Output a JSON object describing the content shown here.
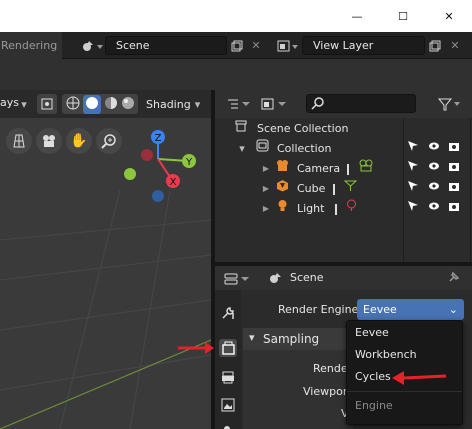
{
  "window": {
    "minimize_label": "—",
    "maximize_label": "☐",
    "close_label": "✕"
  },
  "topbar": {
    "workspace_tab": "Rendering",
    "scene_name": "Scene",
    "view_layer_name": "View Layer"
  },
  "viewport": {
    "mode_fragment": "ays",
    "shading_label": "Shading"
  },
  "outliner": {
    "items": [
      {
        "label": "Scene Collection"
      },
      {
        "label": "Collection"
      },
      {
        "label": "Camera"
      },
      {
        "label": "Cube"
      },
      {
        "label": "Light"
      }
    ]
  },
  "properties": {
    "context_title": "Scene",
    "render_engine_label": "Render Engine",
    "render_engine_value": "Eevee",
    "sampling_label": "Sampling",
    "render_label": "Render",
    "viewport_label": "Viewport",
    "denoising_fragment": "V"
  },
  "engine_dropdown": {
    "options": [
      "Eevee",
      "Workbench",
      "Cycles"
    ],
    "title": "Engine"
  },
  "colors": {
    "arrow_red": "#e8202a",
    "accent_blue": "#4772b3",
    "axis_x": "#ed3a4f",
    "axis_y": "#8cc63f",
    "axis_z": "#3b82f6"
  }
}
